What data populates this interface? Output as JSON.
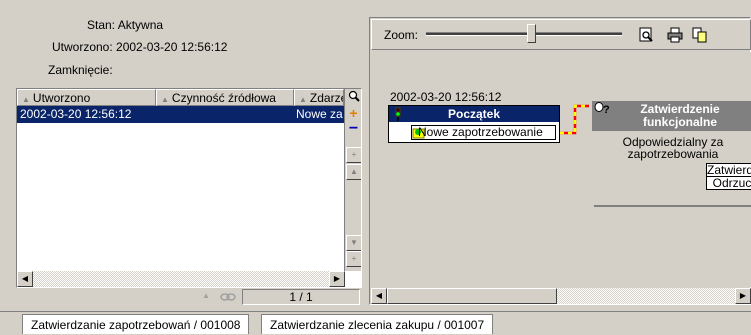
{
  "info": {
    "stan": "Stan: Aktywna",
    "utworzono": "Utworzono: 2002-03-20 12:56:12",
    "zamkniecie": "Zamknięcie:"
  },
  "table": {
    "columns": [
      "Utworzono",
      "Czynność źródłowa",
      "Zdarzenie"
    ],
    "rows": [
      {
        "utworzono": "2002-03-20 12:56:12",
        "czynnosc": "",
        "zdarzenie": "Nowe za"
      }
    ],
    "pager": "1 / 1"
  },
  "toolbar": {
    "zoom_label": "Zoom:",
    "zoom_value": 0.54
  },
  "diagram": {
    "timestamp": "2002-03-20 12:56:12",
    "start_node": {
      "title": "Początek",
      "event": "Nowe zapotrzebowanie"
    },
    "approval_node": {
      "title_line1": "Zatwierdzenie",
      "title_line2": "funkcjonalne",
      "desc_line1": "Odpowiedzialny za",
      "desc_line2": "zapotrzebowania",
      "outcomes": [
        "Zatwierdzi",
        "Odrzuci"
      ]
    }
  },
  "tabs": [
    "Zatwierdzanie zapotrzebowań / 001008",
    "Zatwierdzanie zlecenia zakupu / 001007"
  ],
  "colors": {
    "selection": "#0a246a",
    "node_title": "#0a246a",
    "approval_title": "#808080",
    "link_red": "#ff0000",
    "link_yellow": "#ffff00"
  }
}
